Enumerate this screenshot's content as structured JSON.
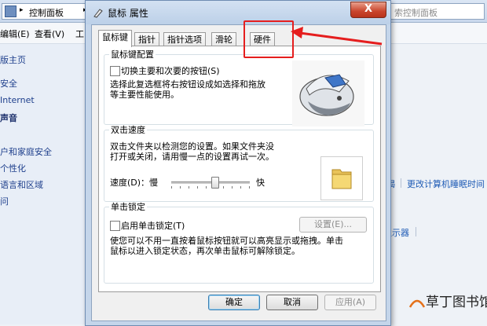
{
  "background": {
    "address": {
      "breadcrumb": "控制面板",
      "search_placeholder": "索控制面板"
    },
    "menu": {
      "edit": "编辑(E)",
      "view": "查看(V)",
      "tools": "工"
    },
    "sidebar": [
      "版主页",
      "安全",
      "Internet",
      "声音",
      "户和家庭安全",
      "个性化",
      "语言和区域",
      "问"
    ],
    "links": {
      "partial_left": "喝",
      "display_sleep": "更改计算机睡眠时间",
      "display": "显示器"
    }
  },
  "dialog": {
    "title": "鼠标 属性",
    "close_label": "X",
    "tabs": [
      "鼠标键",
      "指针",
      "指针选项",
      "滑轮",
      "硬件"
    ],
    "active_tab": "鼠标键",
    "button_config": {
      "legend": "鼠标键配置",
      "switch_label": "切换主要和次要的按钮(S)",
      "switch_checked": false,
      "description": [
        "选择此复选框将右按钮设成如选择和拖放",
        "等主要性能使用。"
      ]
    },
    "double_click": {
      "legend": "双击速度",
      "description": [
        "双击文件夹以检测您的设置。如果文件夹没",
        "打开或关闭，请用慢一点的设置再试一次。"
      ],
      "speed_label": "速度(D)：慢",
      "fast_label": "快",
      "speed_level": 0.55
    },
    "click_lock": {
      "legend": "单击锁定",
      "enable_label": "启用单击锁定(T)",
      "enable_checked": false,
      "settings_button": "设置(E)...",
      "description": [
        "使您可以不用一直按着鼠标按钮就可以高亮显示或拖拽。单击",
        "鼠标以进入锁定状态，再次单击鼠标可解除锁定。"
      ]
    },
    "buttons": {
      "ok": "确定",
      "cancel": "取消",
      "apply": "应用(A)"
    }
  },
  "annotation": {
    "highlight_color": "#e51e1e"
  },
  "watermark": "草丁图书馆"
}
